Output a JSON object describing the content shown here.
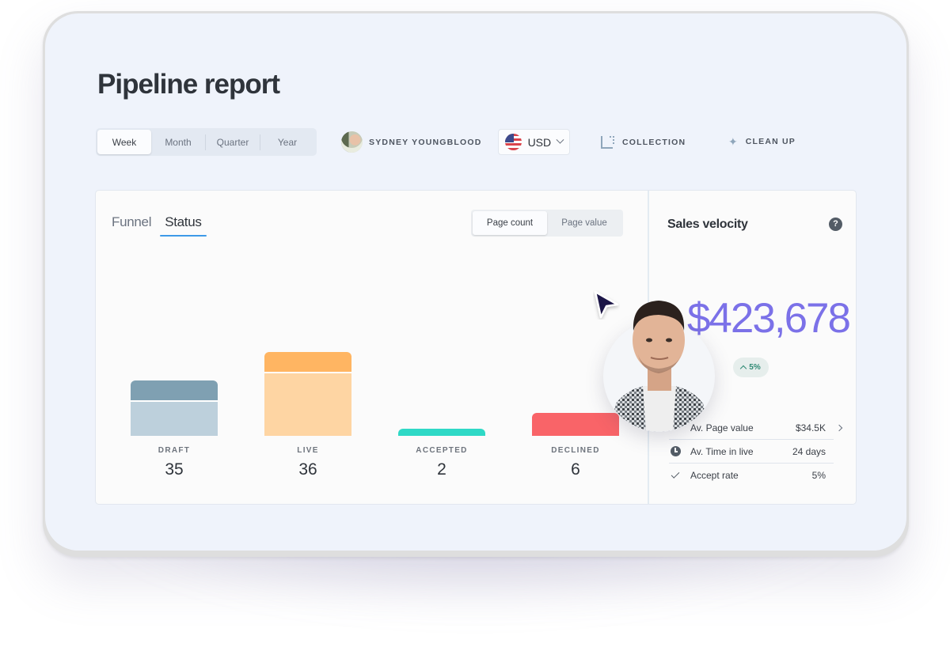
{
  "page": {
    "title": "Pipeline report"
  },
  "toolbar": {
    "periods": [
      {
        "label": "Week",
        "active": true
      },
      {
        "label": "Month",
        "active": false
      },
      {
        "label": "Quarter",
        "active": false
      },
      {
        "label": "Year",
        "active": false
      }
    ],
    "user_name": "SYDNEY YOUNGBLOOD",
    "currency": {
      "value": "USD",
      "flag_icon": "us-flag-icon"
    },
    "collection_label": "COLLECTION",
    "cleanup_label": "CLEAN UP"
  },
  "report": {
    "tabs": [
      {
        "label": "Funnel",
        "active": false
      },
      {
        "label": "Status",
        "active": true
      }
    ],
    "metric_toggle": [
      {
        "label": "Page count",
        "active": true
      },
      {
        "label": "Page value",
        "active": false
      }
    ],
    "colors": {
      "draft": "#7fa0b2",
      "draft_body": "#bdd0dc",
      "live": "#ffb562",
      "live_body": "#fed5a3",
      "accepted": "#2fd9c6",
      "declined": "#f96468"
    }
  },
  "chart_data": {
    "type": "bar",
    "title": "",
    "xlabel": "",
    "ylabel": "",
    "categories": [
      "DRAFT",
      "LIVE",
      "ACCEPTED",
      "DECLINED"
    ],
    "values": [
      35,
      36,
      2,
      6
    ],
    "value_labels": [
      "35",
      "36",
      "2",
      "6"
    ]
  },
  "sales_velocity": {
    "title": "Sales velocity",
    "value": "$423,678",
    "trend": "5%",
    "trend_direction": "up",
    "stats": [
      {
        "icon": "tag-icon",
        "label": "Av. Page value",
        "value": "$34.5K",
        "has_chevron": true
      },
      {
        "icon": "clock-icon",
        "label": "Av. Time in live",
        "value": "24 days",
        "has_chevron": false
      },
      {
        "icon": "check-icon",
        "label": "Accept rate",
        "value": "5%",
        "has_chevron": false
      }
    ]
  }
}
